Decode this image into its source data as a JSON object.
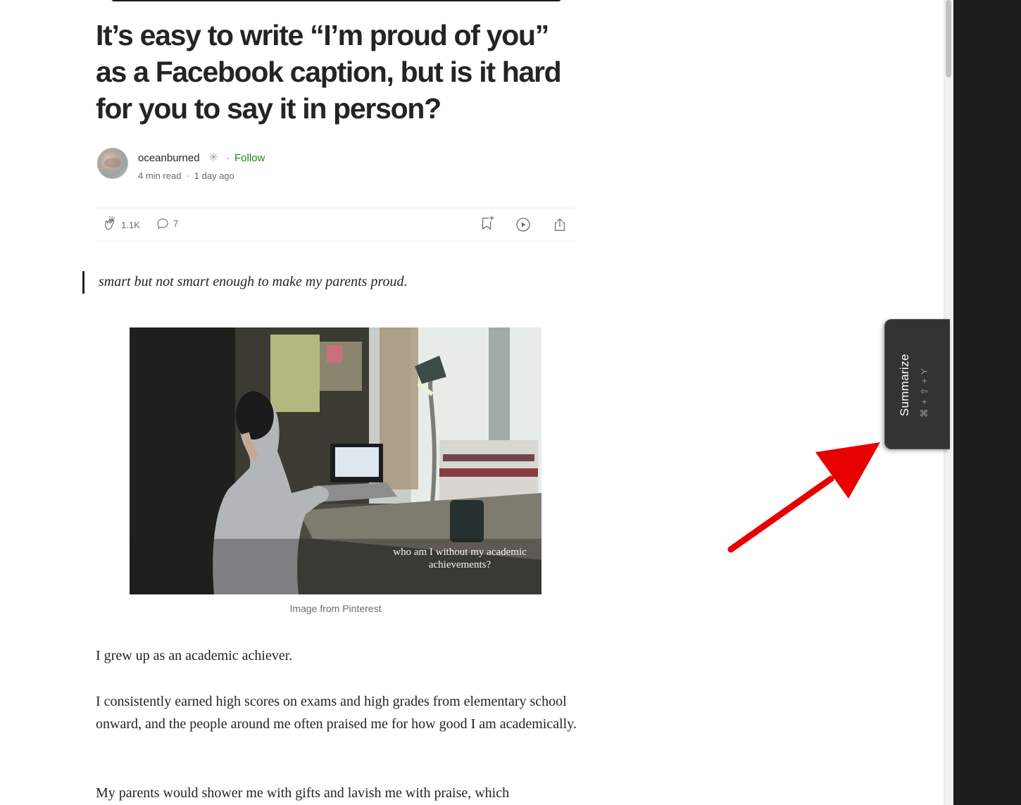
{
  "article": {
    "title": "It’s easy to write “I’m proud of you” as a Facebook caption, but is it hard for you to say it in person?",
    "author": {
      "name": "oceanburned",
      "follow_label": "Follow",
      "separator": "·",
      "read_time": "4 min read",
      "published": "1 day ago"
    },
    "actions": {
      "clap_count": "1.1K",
      "comment_count": "7"
    },
    "quote": "smart but not smart enough to make my parents proud.",
    "image": {
      "overlay_text": "who am I without my academic achievements?",
      "caption": "Image from Pinterest"
    },
    "paragraphs": [
      "I grew up as an academic achiever.",
      "I consistently earned high scores on exams and high grades from elementary school onward, and the people around me often praised me for how good I am academically.",
      "My parents would shower me with gifts and lavish me with praise, which"
    ]
  },
  "extension": {
    "summarize_label": "Summarize",
    "shortcut": "⌘ + ⇧ + Y"
  },
  "colors": {
    "follow": "#1a8917",
    "annotation_arrow": "#e80000",
    "tab_background": "#333333"
  }
}
